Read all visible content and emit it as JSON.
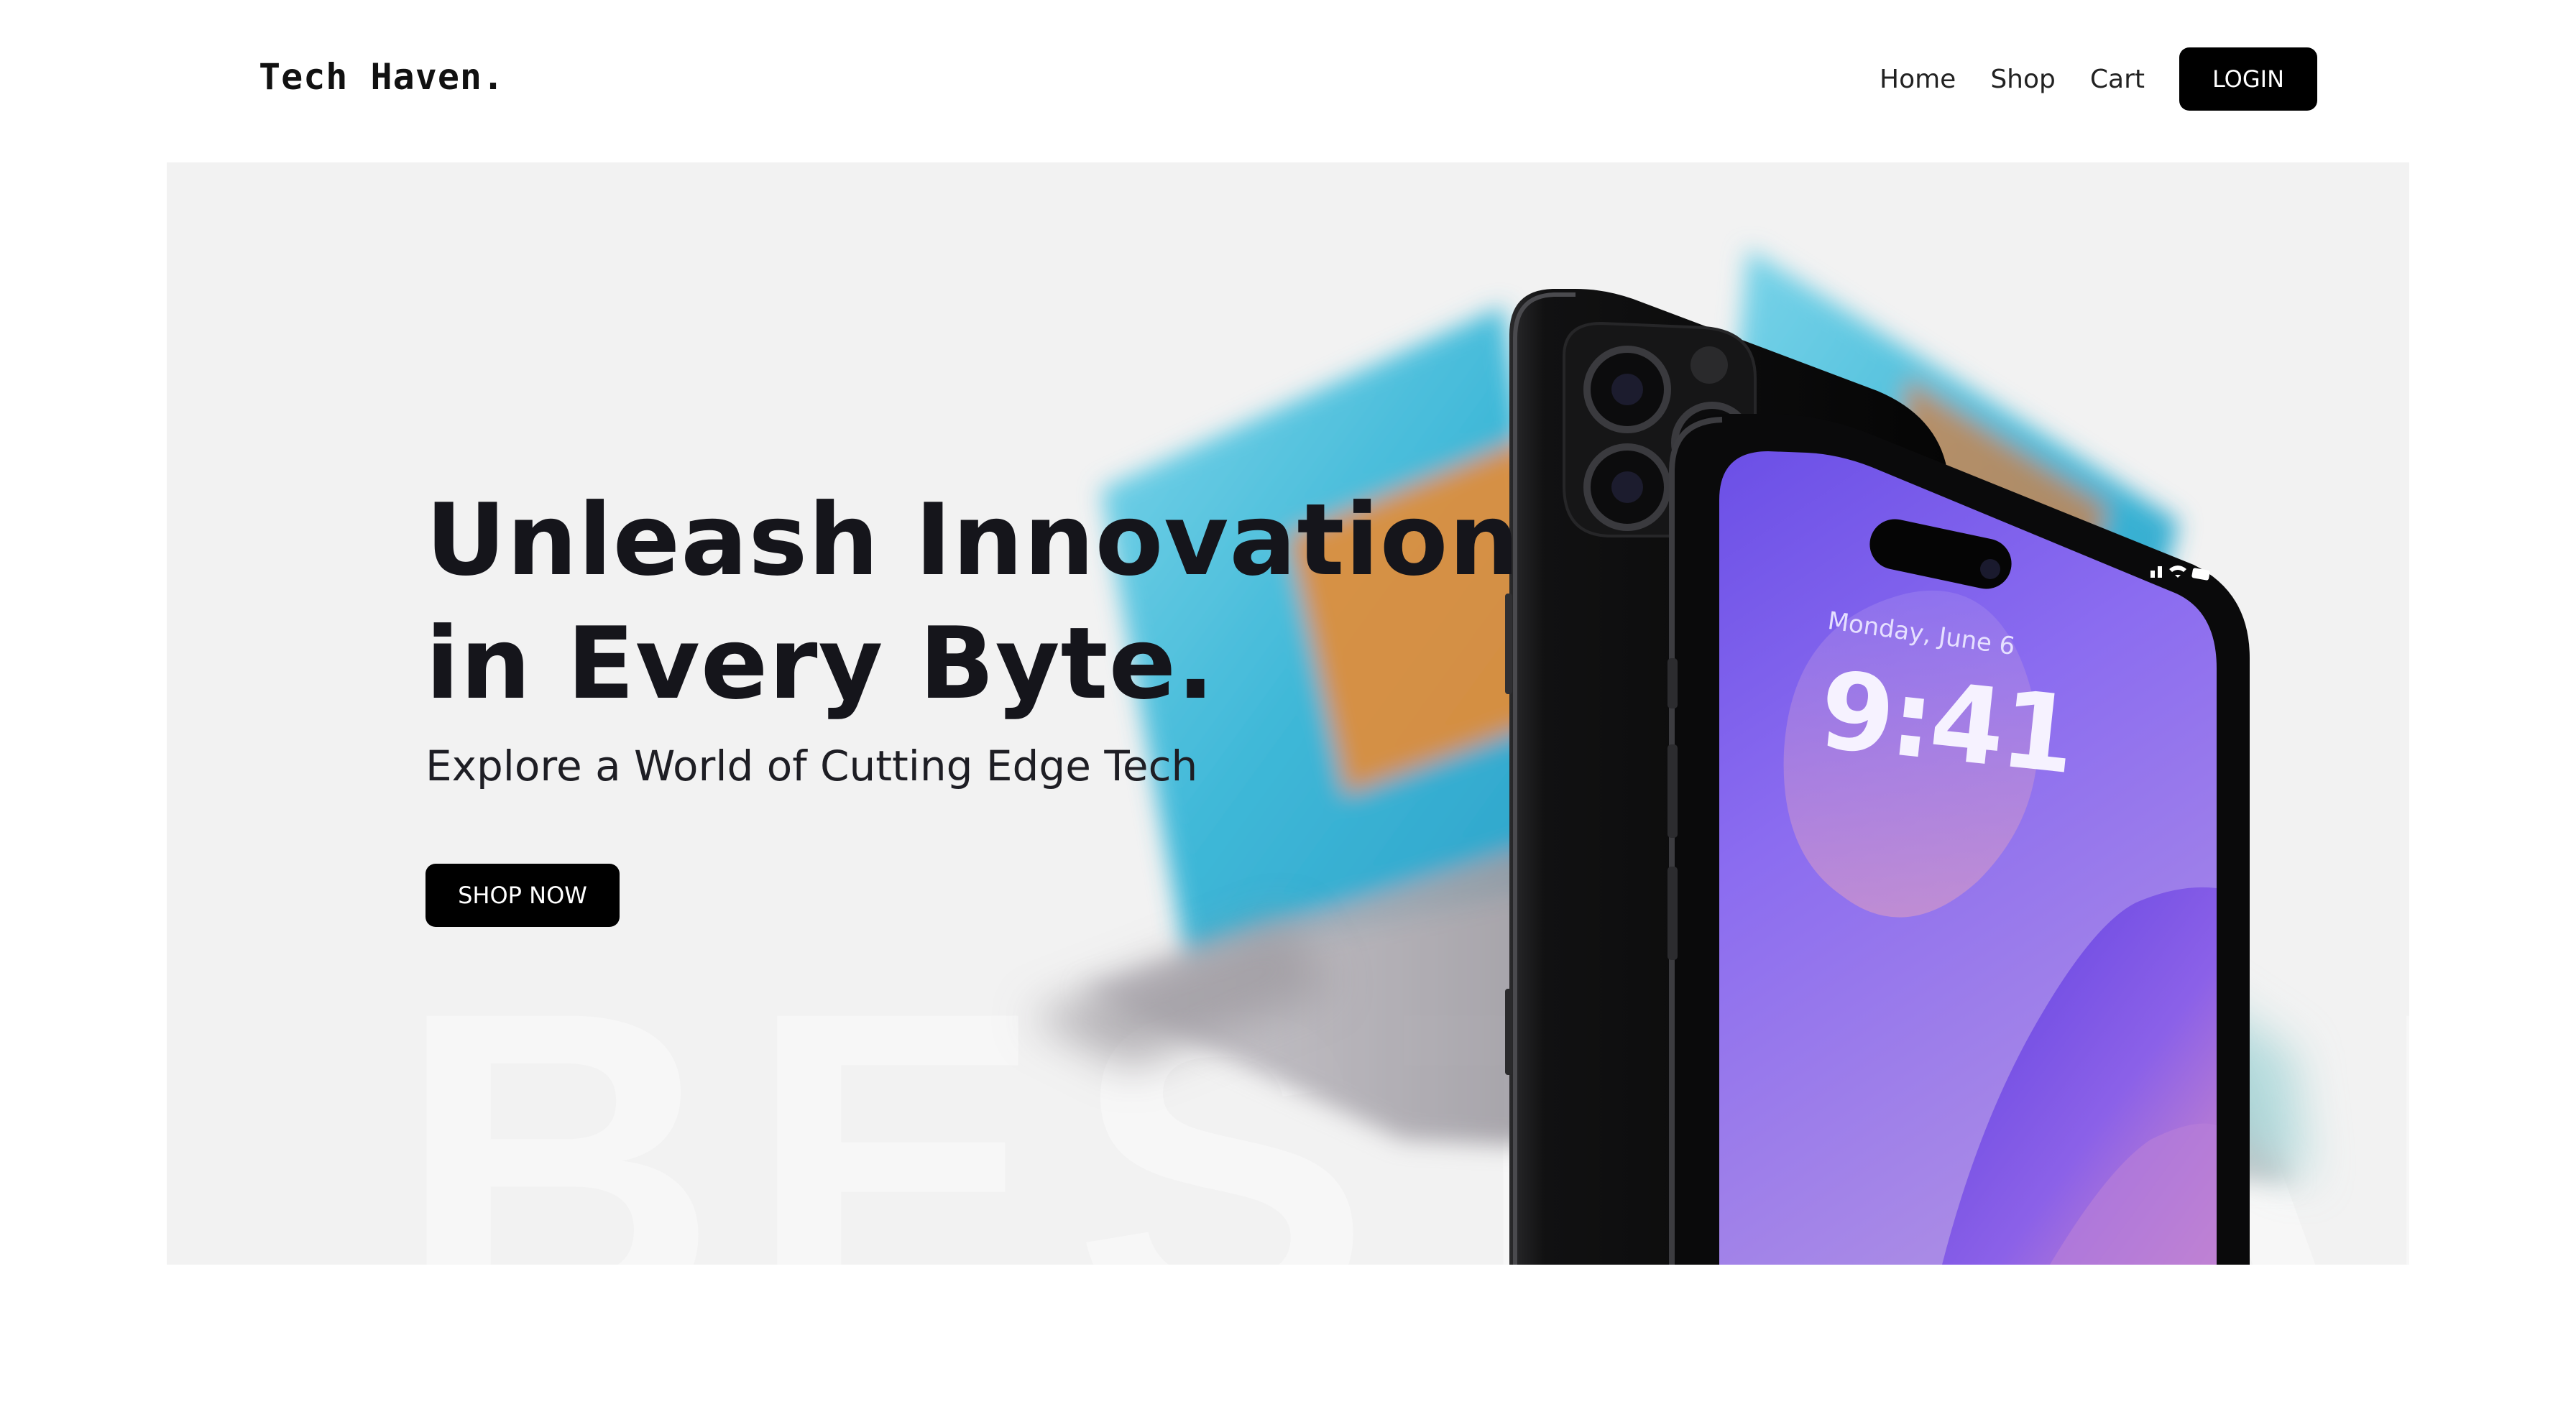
{
  "header": {
    "brand": "Tech Haven.",
    "nav": [
      {
        "label": "Home"
      },
      {
        "label": "Shop"
      },
      {
        "label": "Cart"
      }
    ],
    "login_label": "LOGIN"
  },
  "hero": {
    "title_line1": "Unleash Innovation",
    "title_line2": "in Every Byte.",
    "subtitle": "Explore a World of Cutting Edge Tech",
    "cta_label": "SHOP NOW",
    "watermark": "BESTSALE",
    "phone": {
      "date": "Monday, June 6",
      "time": "9:41"
    }
  },
  "colors": {
    "hero_bg": "#f2f2f2",
    "button_bg": "#000000",
    "button_text": "#ffffff",
    "heading": "#15151b",
    "screen_purple": "#7c5ce8"
  },
  "icons": [
    "signal-icon",
    "wifi-icon",
    "battery-icon"
  ]
}
